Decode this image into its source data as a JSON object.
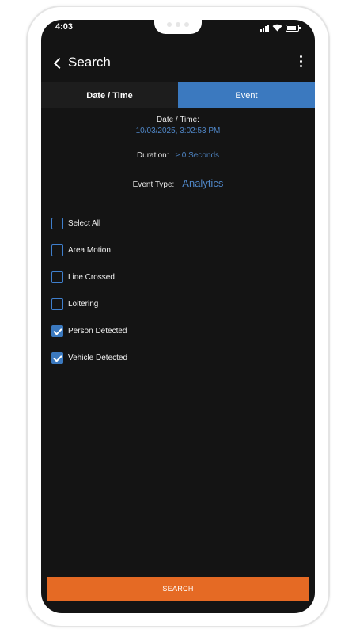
{
  "status_bar": {
    "time": "4:03"
  },
  "header": {
    "title": "Search"
  },
  "tabs": [
    {
      "label": "Date / Time",
      "active": false
    },
    {
      "label": "Event",
      "active": true
    }
  ],
  "datetime": {
    "label": "Date / Time:",
    "value": "10/03/2025, 3:02:53 PM"
  },
  "duration": {
    "label": "Duration:",
    "value": "≥ 0 Seconds"
  },
  "event_type": {
    "label": "Event Type:",
    "value": "Analytics"
  },
  "checkboxes": [
    {
      "label": "Select All",
      "checked": false
    },
    {
      "label": "Area Motion",
      "checked": false
    },
    {
      "label": "Line Crossed",
      "checked": false
    },
    {
      "label": "Loitering",
      "checked": false
    },
    {
      "label": "Person Detected",
      "checked": true
    },
    {
      "label": "Vehicle Detected",
      "checked": true
    }
  ],
  "search_button": {
    "label": "SEARCH"
  },
  "colors": {
    "accent": "#3b79bf",
    "link": "#4f86c6",
    "search": "#e56a24",
    "background": "#141414"
  }
}
